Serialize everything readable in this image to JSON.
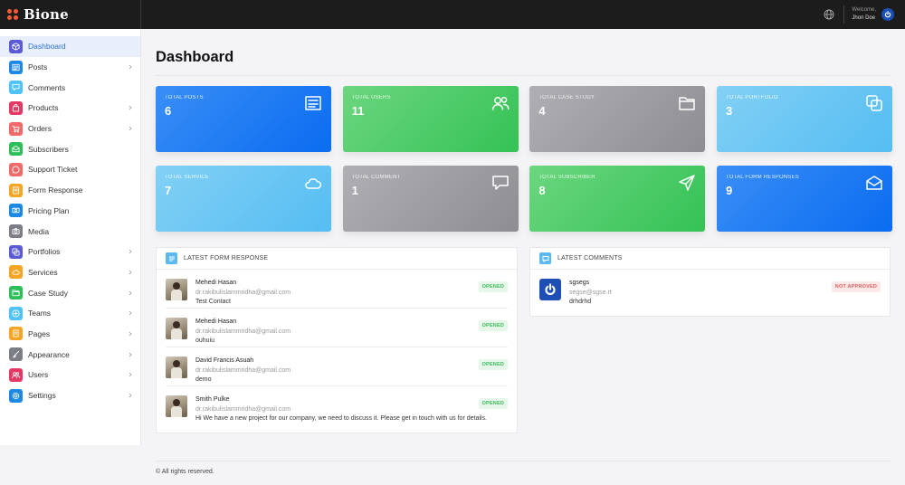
{
  "brand": {
    "name": "Bione"
  },
  "header": {
    "welcome": "Welcome,",
    "user": "Jhon Doe"
  },
  "sidebar": {
    "items": [
      {
        "label": "Dashboard",
        "icon": "box-icon",
        "color": "#5b5bd6",
        "chevron": false,
        "active": true
      },
      {
        "label": "Posts",
        "icon": "newspaper-icon",
        "color": "#1e88e5",
        "chevron": true
      },
      {
        "label": "Comments",
        "icon": "comment-icon",
        "color": "#4fc3f7",
        "chevron": false
      },
      {
        "label": "Products",
        "icon": "bag-icon",
        "color": "#e53965",
        "chevron": true
      },
      {
        "label": "Orders",
        "icon": "cart-icon",
        "color": "#f06a6a",
        "chevron": true
      },
      {
        "label": "Subscribers",
        "icon": "mail-open-icon",
        "color": "#2fbf5a",
        "chevron": false
      },
      {
        "label": "Support Ticket",
        "icon": "whatsapp-icon",
        "color": "#f06a6a",
        "chevron": false
      },
      {
        "label": "Form Response",
        "icon": "form-icon",
        "color": "#f5a524",
        "chevron": false
      },
      {
        "label": "Pricing Plan",
        "icon": "money-icon",
        "color": "#1e88e5",
        "chevron": false
      },
      {
        "label": "Media",
        "icon": "camera-icon",
        "color": "#7d7d85",
        "chevron": false
      },
      {
        "label": "Portfolios",
        "icon": "layers-icon",
        "color": "#5b5bd6",
        "chevron": true
      },
      {
        "label": "Services",
        "icon": "cloud-icon",
        "color": "#f5a524",
        "chevron": true
      },
      {
        "label": "Case Study",
        "icon": "folder-icon",
        "color": "#2fbf5a",
        "chevron": true
      },
      {
        "label": "Teams",
        "icon": "circle-plus-icon",
        "color": "#4fc3f7",
        "chevron": true
      },
      {
        "label": "Pages",
        "icon": "pages-icon",
        "color": "#f5a524",
        "chevron": true
      },
      {
        "label": "Appearance",
        "icon": "brush-icon",
        "color": "#7d7d85",
        "chevron": true
      },
      {
        "label": "Users",
        "icon": "users-icon",
        "color": "#e53965",
        "chevron": true
      },
      {
        "label": "Settings",
        "icon": "gear-icon",
        "color": "#1e88e5",
        "chevron": true
      }
    ]
  },
  "page": {
    "title": "Dashboard"
  },
  "stats": [
    {
      "label": "TOTAL POSTS",
      "value": "6",
      "icon": "newspaper-icon",
      "tone": "blue"
    },
    {
      "label": "TOTAL USERS",
      "value": "11",
      "icon": "users-icon",
      "tone": "green"
    },
    {
      "label": "TOTAL CASE STUDY",
      "value": "4",
      "icon": "folder-icon",
      "tone": "gray"
    },
    {
      "label": "TOTAL PORTFOLIO",
      "value": "3",
      "icon": "layers-icon",
      "tone": "sky"
    },
    {
      "label": "TOTAL SERVICE",
      "value": "7",
      "icon": "cloud-icon",
      "tone": "sky"
    },
    {
      "label": "TOTAL COMMENT",
      "value": "1",
      "icon": "comment-icon",
      "tone": "gray"
    },
    {
      "label": "TOTAL SUBSCRIBER",
      "value": "8",
      "icon": "send-icon",
      "tone": "green"
    },
    {
      "label": "TOTAL FORM RESPONSES",
      "value": "9",
      "icon": "mail-open-icon",
      "tone": "blue"
    }
  ],
  "form_responses": {
    "title": "LATEST FORM RESPONSE",
    "items": [
      {
        "name": "Mehedi Hasan",
        "email": "dr.rakibulislammridha@gmail.com",
        "message": "Test Contact",
        "status": "OPENED"
      },
      {
        "name": "Mehedi Hasan",
        "email": "dr.rakibulislammridha@gmail.com",
        "message": "ouhuiu",
        "status": "OPENED"
      },
      {
        "name": "David Francis Asuah",
        "email": "dr.rakibulislammridha@gmail.com",
        "message": "demo",
        "status": "OPENED"
      },
      {
        "name": "Smith Pulke",
        "email": "dr.rakibulislammridha@gmail.com",
        "message": "Hi We have a new project for our company, we need to discuss it. Please get in touch with us for details.",
        "status": "OPENED"
      }
    ]
  },
  "comments": {
    "title": "LATEST COMMENTS",
    "items": [
      {
        "name": "sgsegs",
        "email": "segse@sgse.rt",
        "message": "drhdrhd",
        "status": "NOT APPROVED"
      }
    ]
  },
  "footer": {
    "text": "© All rights reserved."
  },
  "colors": {
    "topbar": "#1c1c1c",
    "brand_accent": "#ff5a36",
    "active_text": "#2b6fd6"
  }
}
